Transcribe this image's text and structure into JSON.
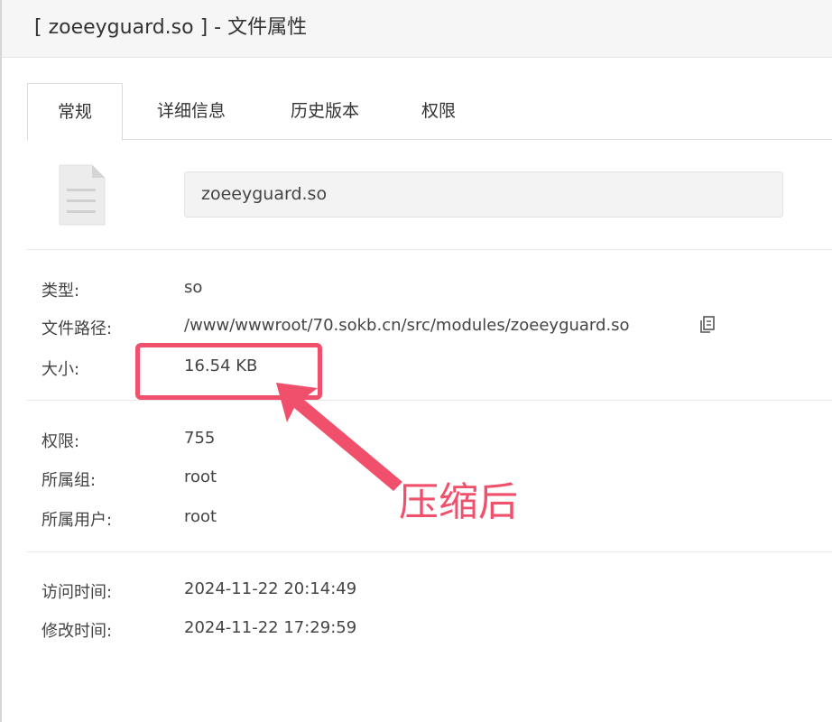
{
  "window": {
    "title": "[ zoeeyguard.so ] - 文件属性"
  },
  "tabs": [
    {
      "label": "常规",
      "active": true
    },
    {
      "label": "详细信息",
      "active": false
    },
    {
      "label": "历史版本",
      "active": false
    },
    {
      "label": "权限",
      "active": false
    }
  ],
  "file": {
    "icon": "document-file-icon",
    "name": "zoeeyguard.so"
  },
  "info": {
    "type_label": "类型:",
    "type_value": "so",
    "path_label": "文件路径:",
    "path_value": "/www/wwwroot/70.sokb.cn/src/modules/zoeeyguard.so",
    "size_label": "大小:",
    "size_value": "16.54 KB",
    "perm_label": "权限:",
    "perm_value": "755",
    "group_label": "所属组:",
    "group_value": "root",
    "owner_label": "所属用户:",
    "owner_value": "root",
    "atime_label": "访问时间:",
    "atime_value": "2024-11-22 20:14:49",
    "mtime_label": "修改时间:",
    "mtime_value": "2024-11-22 17:29:59"
  },
  "annotation": {
    "text": "压缩后",
    "color": "#f0506b"
  },
  "colors": {
    "titlebar_bg": "#f6f6f6",
    "input_bg": "#f3f3f3",
    "accent": "#f0506b"
  }
}
